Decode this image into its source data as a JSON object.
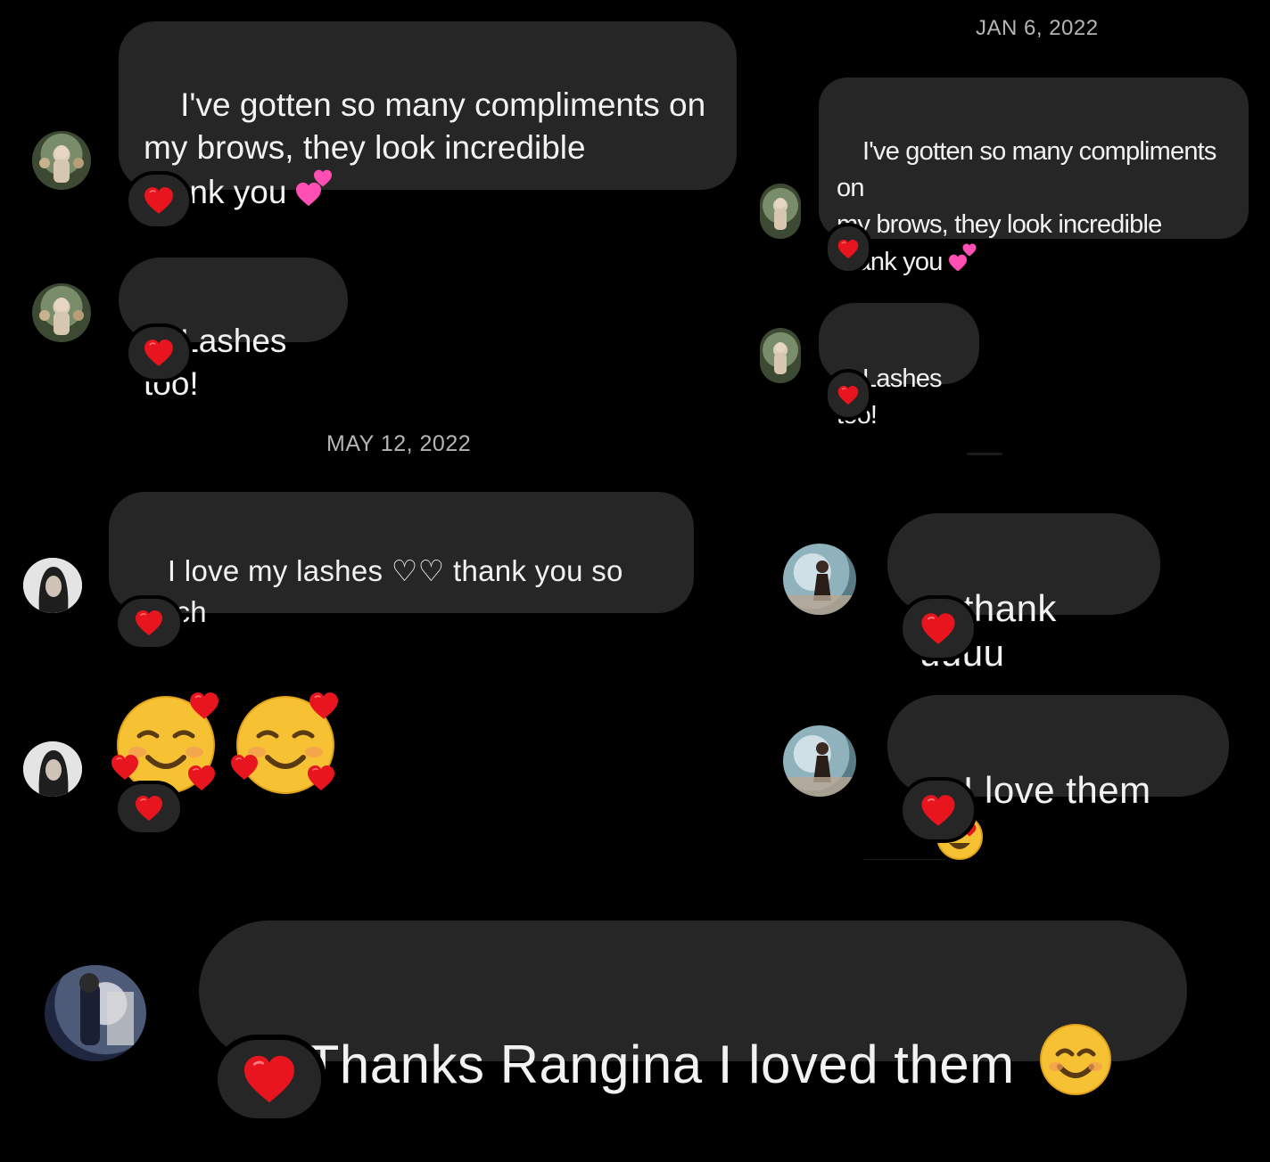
{
  "colors": {
    "background": "#000000",
    "bubble": "#262626",
    "text": "#f2f2f2",
    "date_text": "#b5b5b5",
    "heart": "#e8141e",
    "emoji_face": "#f6c233"
  },
  "panel_top_left": {
    "messages": [
      {
        "text": "I've gotten so many compliments on\nmy brows, they look incredible\nthank you",
        "trailing_emoji": "two-hearts-emoji",
        "reaction": "red-heart-icon"
      },
      {
        "text": "Lashes too!",
        "reaction": "red-heart-icon"
      }
    ]
  },
  "panel_top_right": {
    "date": "JAN 6, 2022",
    "messages": [
      {
        "text": "I've gotten so many compliments on\nmy brows, they look incredible\nthank you",
        "trailing_emoji": "two-hearts-emoji",
        "reaction": "red-heart-icon"
      },
      {
        "text": "Lashes too!",
        "reaction": "red-heart-icon"
      }
    ]
  },
  "panel_middle_left": {
    "date": "MAY 12, 2022",
    "messages": [
      {
        "text": "I love my lashes ♡♡ thank you so\nmuch",
        "reaction": "red-heart-icon"
      },
      {
        "emoji": "smiling-face-with-hearts-emoji",
        "count": 2,
        "reaction": "red-heart-icon"
      }
    ]
  },
  "panel_middle_right": {
    "messages": [
      {
        "text": "thank uuuu",
        "reaction": "red-heart-icon"
      },
      {
        "text": "I love them",
        "trailing_emoji": "heart-eyes-emoji",
        "reaction": "red-heart-icon"
      }
    ]
  },
  "panel_bottom": {
    "messages": [
      {
        "text": "Thanks Rangina I loved them",
        "trailing_emoji": "smiling-face-emoji",
        "reaction": "red-heart-icon"
      }
    ]
  }
}
